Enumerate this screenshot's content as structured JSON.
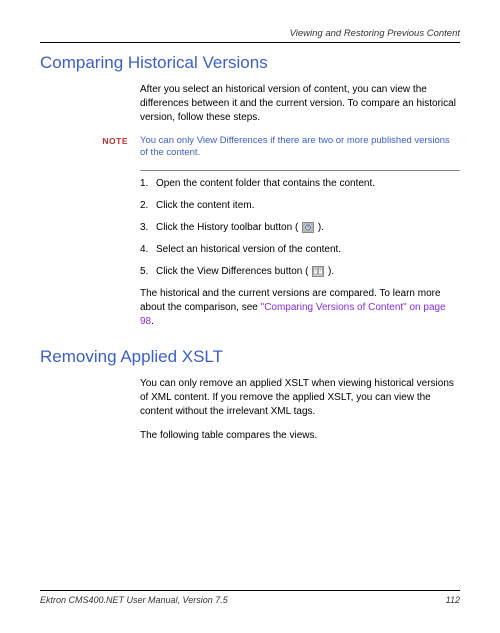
{
  "header": {
    "breadcrumb": "Viewing and Restoring Previous Content"
  },
  "section1": {
    "title": "Comparing Historical Versions",
    "intro": "After you select an historical version of content, you can view the differences between it and the current version. To compare an historical version, follow these steps.",
    "noteLabel": "NOTE",
    "noteText": "You can only View Differences if there are two or more published versions of the content.",
    "steps": [
      "Open the content folder that contains the content.",
      "Click the content item.",
      "Click the History toolbar button (",
      "Select an historical version of the content.",
      "Click the View Differences button ("
    ],
    "stepClose": ").",
    "outro1": "The historical and the current versions are compared. To learn more about the comparison, see ",
    "outroLink": "\"Comparing Versions of Content\" on page 98",
    "outroEnd": "."
  },
  "section2": {
    "title": "Removing Applied XSLT",
    "para1": "You can only remove an applied XSLT when viewing historical versions of XML content. If you remove the applied XSLT, you can view the content without the irrelevant XML tags.",
    "para2": "The following table compares the views."
  },
  "footer": {
    "left": "Ektron CMS400.NET User Manual, Version 7.5",
    "page": "112"
  }
}
